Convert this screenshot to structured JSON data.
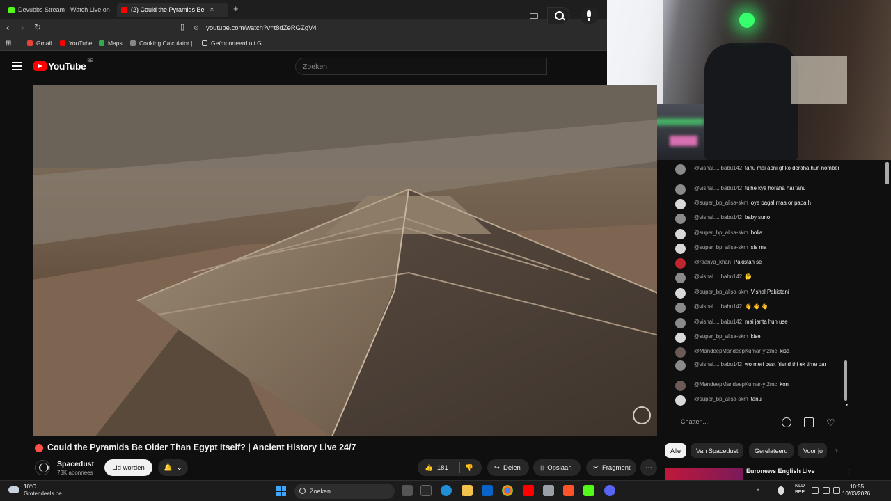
{
  "browser": {
    "tabs": [
      {
        "label": "Devubbs Stream - Watch Live on",
        "active": false,
        "favicon_color": "#53fc18"
      },
      {
        "label": "(2) Could the Pyramids Be",
        "active": true,
        "favicon_color": "#ff0000"
      }
    ],
    "close_glyph": "×",
    "new_tab_glyph": "+",
    "url": "youtube.com/watch?v=t8dZeRGZgV4",
    "bookmarks": [
      "Gmail",
      "YouTube",
      "Maps",
      "Cooking Calculator |...",
      "Geïmporteerd uit G..."
    ]
  },
  "youtube": {
    "logo_word": "YouTube",
    "country_code": "BE",
    "search_placeholder": "Zoeken"
  },
  "video": {
    "title": "Could the Pyramids Be Older Than Egypt Itself? | Ancient History Live 24/7",
    "channel": "Spacedust",
    "subscribers": "73K abonnees",
    "join_label": "Lid worden",
    "likes": "181",
    "share_label": "Delen",
    "save_label": "Opslaan",
    "clip_label": "Fragment"
  },
  "chat": {
    "messages": [
      {
        "author": "@vishal.....babu142",
        "text": "tanu mai apni gf ko deraha hun nomber",
        "avatar_color": "#8a8a8a"
      },
      {
        "author": "@vishal.....babu142",
        "text": "tujhe kya horaha hai tanu",
        "avatar_color": "#8a8a8a"
      },
      {
        "author": "@super_bp_alisa-skm",
        "text": "oye pagal maa or papa h",
        "avatar_color": "#d9d9d9"
      },
      {
        "author": "@vishal.....babu142",
        "text": "baby suno",
        "avatar_color": "#8a8a8a"
      },
      {
        "author": "@super_bp_alisa-skm",
        "text": "bolia",
        "avatar_color": "#d9d9d9"
      },
      {
        "author": "@super_bp_alisa-skm",
        "text": "sis ma",
        "avatar_color": "#d9d9d9"
      },
      {
        "author": "@raanya_khan",
        "text": "Pakistan se",
        "avatar_color": "#c0262d"
      },
      {
        "author": "@vishal.....babu142",
        "text": "🤔",
        "avatar_color": "#8a8a8a"
      },
      {
        "author": "@super_bp_alisa-skm",
        "text": "Vishal Pakistani",
        "avatar_color": "#d9d9d9"
      },
      {
        "author": "@vishal.....babu142",
        "text": "👋 👋 👋",
        "avatar_color": "#8a8a8a"
      },
      {
        "author": "@vishal.....babu142",
        "text": "mai janta hun use",
        "avatar_color": "#8a8a8a"
      },
      {
        "author": "@super_bp_alisa-skm",
        "text": "kise",
        "avatar_color": "#d9d9d9"
      },
      {
        "author": "@MandeepMandeepKumar-yt2mc",
        "text": "kisa",
        "avatar_color": "#6b5a55"
      },
      {
        "author": "@vishal.....babu142",
        "text": "wo meri best friend thi ek time par",
        "avatar_color": "#8a8a8a"
      },
      {
        "author": "@MandeepMandeepKumar-yt2mc",
        "text": "kon",
        "avatar_color": "#6b5a55"
      },
      {
        "author": "@super_bp_alisa-skm",
        "text": "tanu",
        "avatar_color": "#d9d9d9"
      }
    ],
    "input_placeholder": "Chatten..."
  },
  "chips": [
    "Alle",
    "Van Spacedust",
    "Gerelateerd",
    "Voor jo"
  ],
  "recommendation": {
    "title": "Euronews English Live"
  },
  "taskbar": {
    "weather_temp": "10°C",
    "weather_desc": "Grotendeels be...",
    "search_label": "Zoeken",
    "lang_line1": "NLD",
    "lang_line2": "BEP",
    "time": "10:55",
    "date": "10/03/2026"
  }
}
